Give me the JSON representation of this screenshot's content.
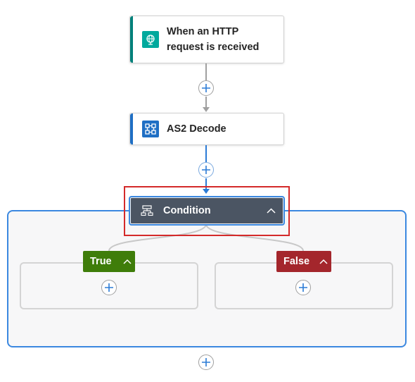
{
  "trigger": {
    "title_line1": "When an HTTP",
    "title_line2": "request is received",
    "icon": "globe-icon",
    "accent": "#00807a"
  },
  "decode_action": {
    "title": "AS2 Decode",
    "icon": "decode-icon",
    "accent": "#1f6fc4"
  },
  "condition": {
    "title": "Condition",
    "icon": "condition-icon",
    "bg": "#4b5563",
    "selection_color": "#d42a2a"
  },
  "branches": {
    "true": {
      "label": "True",
      "color": "#3f7d0a"
    },
    "false": {
      "label": "False",
      "color": "#a4262c"
    }
  },
  "colors": {
    "scope_border": "#3b88e0",
    "connector_gray": "#a0a0a0",
    "connector_blue": "#2b7bd6"
  }
}
